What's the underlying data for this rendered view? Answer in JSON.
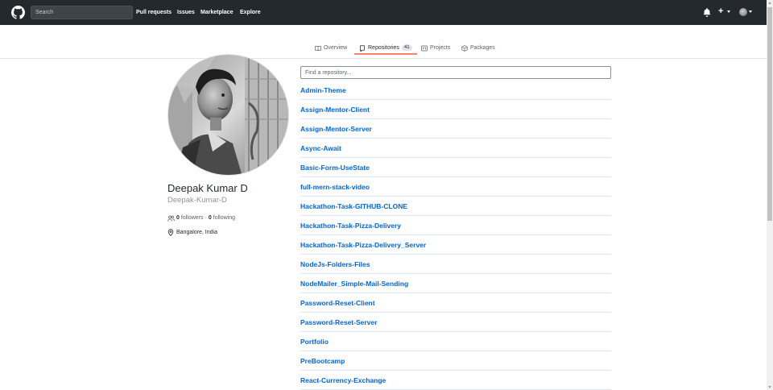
{
  "header": {
    "search_placeholder": "Search",
    "nav": [
      "Pull requests",
      "Issues",
      "Marketplace",
      "Explore"
    ],
    "plus_label": "+"
  },
  "tabs": [
    {
      "label": "Overview",
      "icon": "book-icon",
      "selected": false
    },
    {
      "label": "Repositories",
      "icon": "repo-icon",
      "count": "41",
      "selected": true
    },
    {
      "label": "Projects",
      "icon": "project-icon",
      "selected": false
    },
    {
      "label": "Packages",
      "icon": "package-icon",
      "selected": false
    }
  ],
  "profile": {
    "name": "Deepak Kumar D",
    "login": "Deepak-Kumar-D",
    "followers_count": "0",
    "followers_label": "followers",
    "separator": "·",
    "following_count": "0",
    "following_label": "following",
    "location": "Bangalore, India"
  },
  "repositories": {
    "filter_placeholder": "Find a repository...",
    "items": [
      "Admin-Theme",
      "Assign-Mentor-Client",
      "Assign-Mentor-Server",
      "Async-Await",
      "Basic-Form-UseState",
      "full-mern-stack-video",
      "Hackathon-Task-GITHUB-CLONE",
      "Hackathon-Task-Pizza-Delivery",
      "Hackathon-Task-Pizza-Delivery_Server",
      "NodeJs-Folders-Files",
      "NodeMailer_Simple-Mail-Sending",
      "Password-Reset-Client",
      "Password-Reset-Server",
      "Portfolio",
      "PreBootcamp",
      "React-Currency-Exchange"
    ]
  },
  "colors": {
    "header_bg": "#24292e",
    "link": "#0366d6",
    "tab_accent": "#f9826c",
    "muted": "#586069"
  }
}
